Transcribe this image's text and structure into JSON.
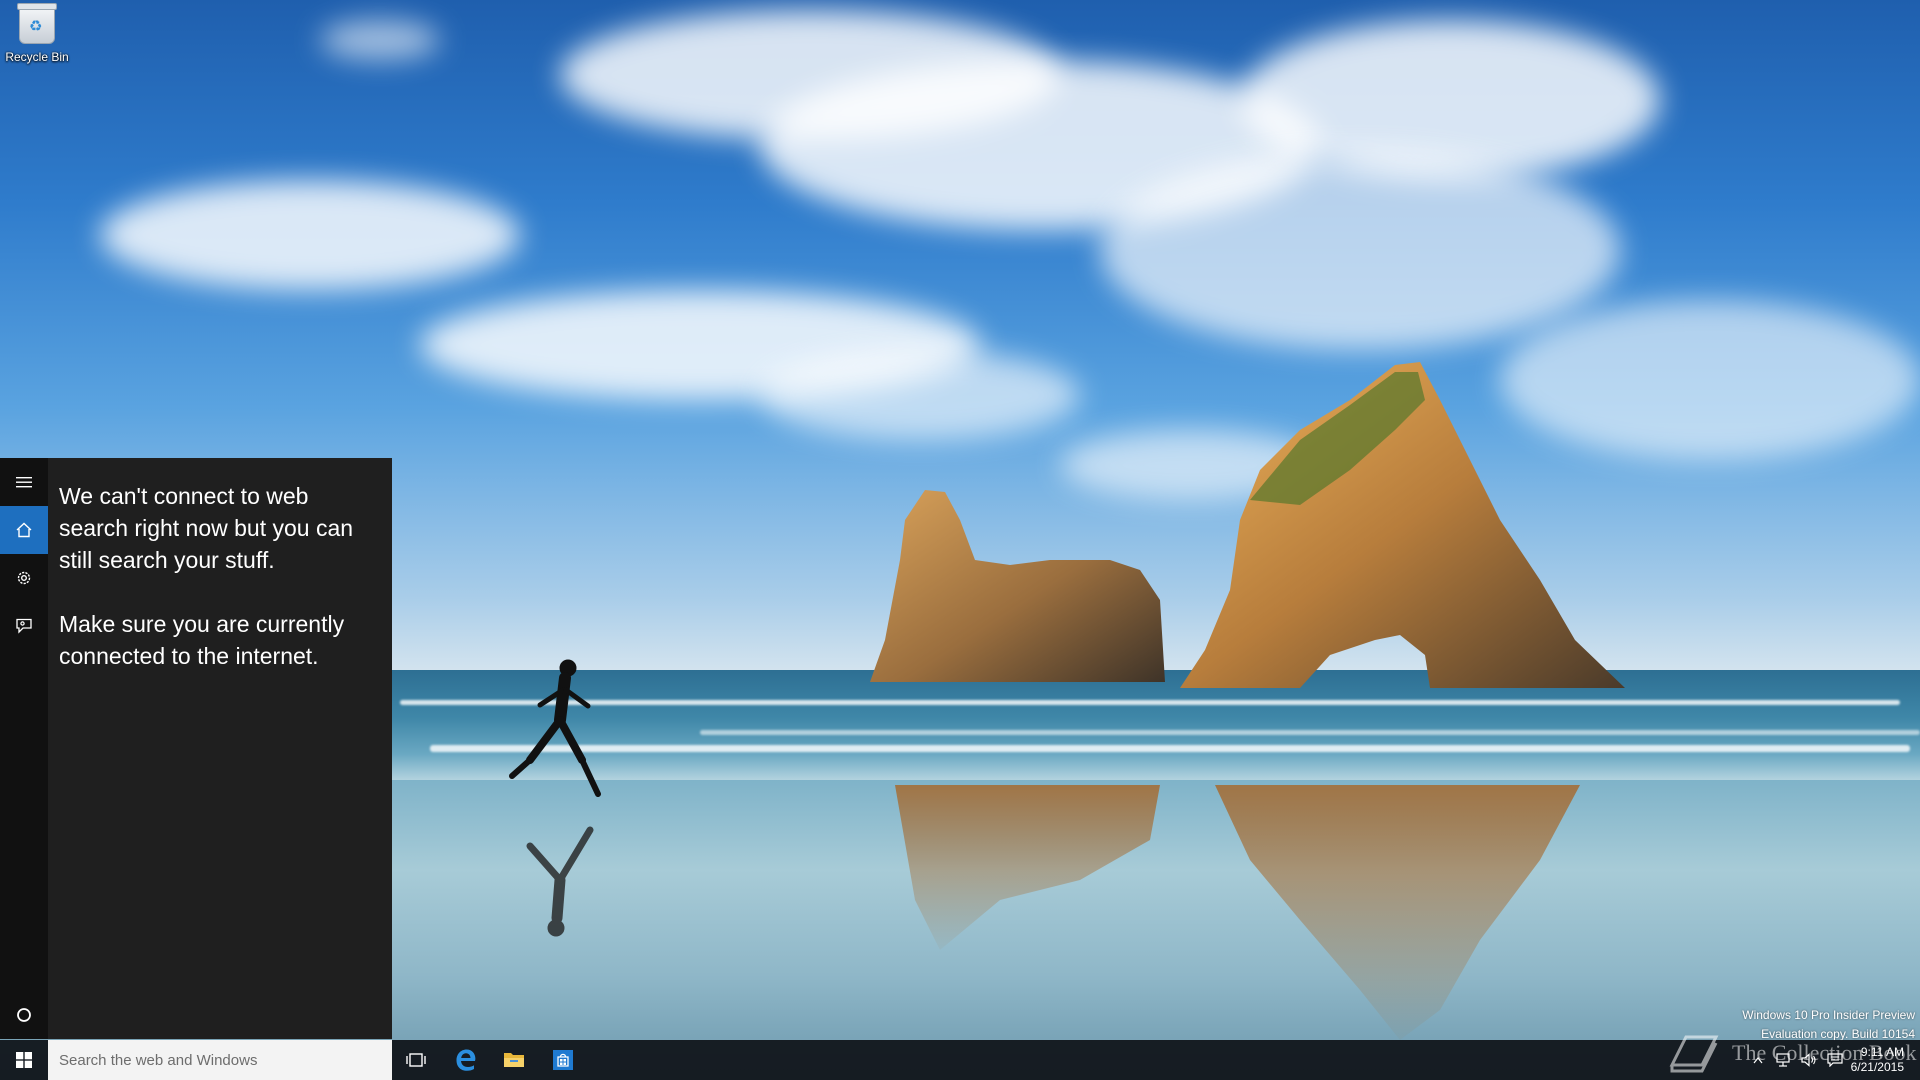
{
  "desktop": {
    "icons": [
      {
        "label": "Recycle Bin",
        "icon": "recycle-bin-icon"
      }
    ],
    "watermark": {
      "line1": "Windows 10 Pro Insider Preview",
      "line2": "Evaluation copy. Build 10154"
    },
    "overlay_text": "The Collection Book"
  },
  "search_panel": {
    "rail": [
      {
        "name": "hamburger-menu-icon",
        "active": false
      },
      {
        "name": "home-icon",
        "active": true
      },
      {
        "name": "settings-gear-icon",
        "active": false
      },
      {
        "name": "feedback-icon",
        "active": false
      },
      {
        "name": "cortana-circle-icon",
        "active": false
      }
    ],
    "messages": [
      "We can't connect to web search right now but you can still search your stuff.",
      "Make sure you are currently connected to the internet."
    ],
    "accent_color": "#1e6fbf",
    "background_color": "#1f1f1f"
  },
  "taskbar": {
    "start_icon": "windows-start-icon",
    "search_placeholder": "Search the web and Windows",
    "pinned": [
      {
        "name": "task-view-icon"
      },
      {
        "name": "edge-browser-icon"
      },
      {
        "name": "file-explorer-icon"
      },
      {
        "name": "store-icon"
      }
    ],
    "tray": [
      {
        "name": "show-hidden-icons-chevron"
      },
      {
        "name": "network-icon"
      },
      {
        "name": "volume-icon"
      },
      {
        "name": "action-center-icon"
      }
    ],
    "clock": {
      "time": "9:11 AM",
      "date": "6/21/2015"
    }
  }
}
